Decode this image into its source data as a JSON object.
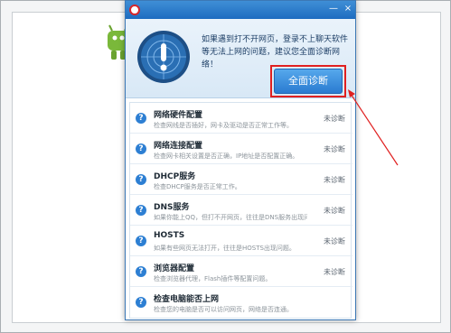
{
  "dialog": {
    "title": "",
    "intro": "如果遇到打不开网页，登录不上聊天软件等无法上网的问题，建议您全面诊断网络！",
    "diagnose_button": "全面诊断",
    "close_glyph": "×",
    "min_glyph": "—"
  },
  "items": [
    {
      "title": "网络硬件配置",
      "desc": "检查网线是否插好，网卡及驱动是否正常工作等。",
      "status": "未诊断",
      "icon": "question-icon"
    },
    {
      "title": "网络连接配置",
      "desc": "检查网卡相关设置是否正确，IP地址是否配置正确。",
      "status": "未诊断",
      "icon": "question-icon"
    },
    {
      "title": "DHCP服务",
      "desc": "检查DHCP服务是否正常工作。",
      "status": "未诊断",
      "icon": "question-icon"
    },
    {
      "title": "DNS服务",
      "desc": "如果你能上QQ，但打不开网页，往往是DNS服务出现问题。",
      "status": "未诊断",
      "icon": "question-icon"
    },
    {
      "title": "HOSTS",
      "desc": "如果有些网页无法打开，往往是HOSTS出现问题。",
      "status": "未诊断",
      "icon": "question-icon"
    },
    {
      "title": "浏览器配置",
      "desc": "检查浏览器代理，Flash插件等配置问题。",
      "status": "未诊断",
      "icon": "question-icon"
    },
    {
      "title": "检查电脑能否上网",
      "desc": "检查您的电脑是否可以访问网页，网络是否连通。",
      "status": "",
      "icon": "question-icon"
    }
  ],
  "colors": {
    "accent": "#2a7bd0",
    "highlight": "#e02020"
  }
}
